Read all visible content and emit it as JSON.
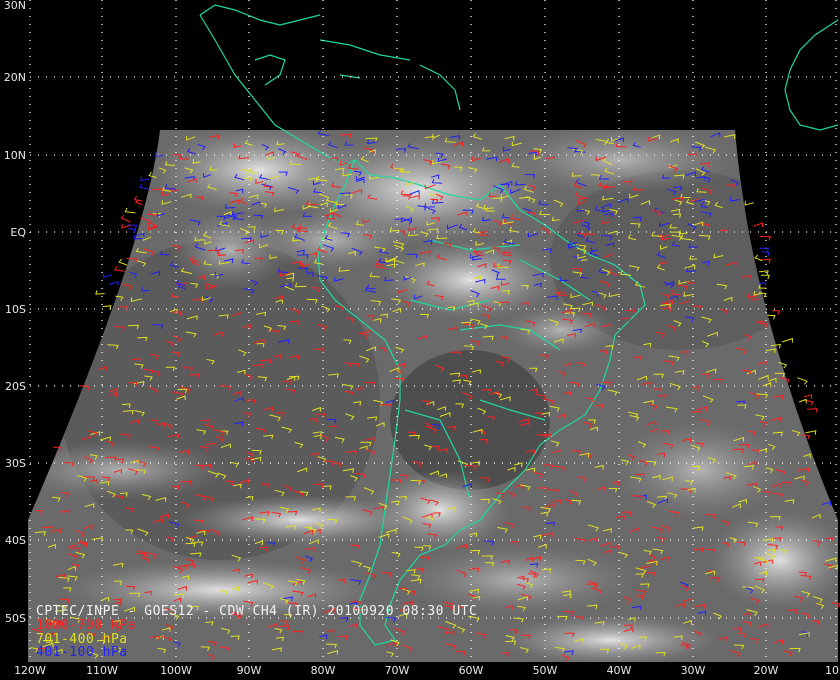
{
  "image": {
    "caption": "CPTEC/INPE - GOES12 - CDW CH4 (IR) 20100920 08:30 UTC",
    "legend": [
      {
        "label": "1000-700 hPa",
        "color": "#ff2020"
      },
      {
        "label": "701-400 hPa",
        "color": "#e0e020"
      },
      {
        "label": "401-100 hPa",
        "color": "#2020ff"
      }
    ]
  },
  "map": {
    "lat_labels": [
      "30N",
      "20N",
      "10N",
      "EQ",
      "10S",
      "20S",
      "30S",
      "40S",
      "50S"
    ],
    "lon_labels": [
      "120W",
      "110W",
      "100W",
      "90W",
      "80W",
      "70W",
      "60W",
      "50W",
      "40W",
      "30W",
      "20W",
      "10"
    ],
    "coastline_color": "#20d8a0",
    "grid_color": "#ffffff"
  }
}
